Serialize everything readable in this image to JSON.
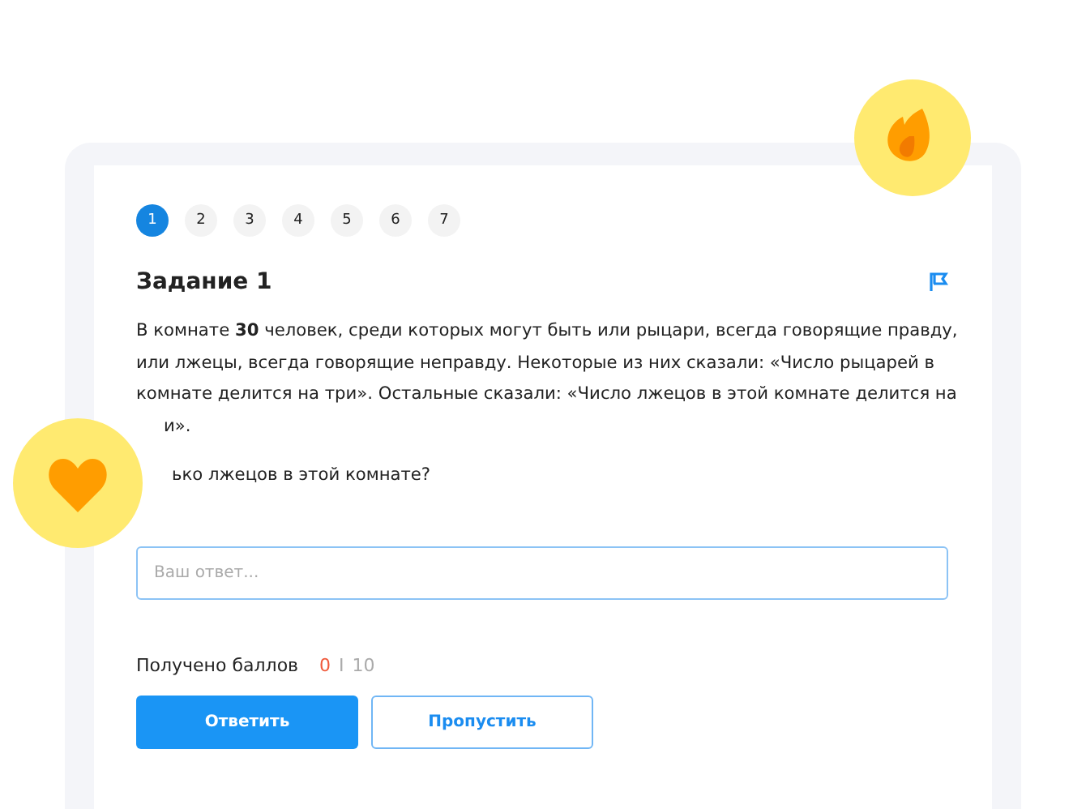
{
  "pages": [
    {
      "label": "1",
      "selected": true
    },
    {
      "label": "2",
      "selected": false
    },
    {
      "label": "3",
      "selected": false
    },
    {
      "label": "4",
      "selected": false
    },
    {
      "label": "5",
      "selected": false
    },
    {
      "label": "6",
      "selected": false
    },
    {
      "label": "7",
      "selected": false
    }
  ],
  "task": {
    "title": "Задание 1",
    "lines": [
      "В комнате **30** человек, среди которых могут быть или рыцари, всегда говорящие правду,",
      "или лжецы, всегда говорящие неправду. Некоторые из них сказали: «Число рыцарей в",
      "комнате делится на три». Остальные сказали: «Число лжецов в этой комнате делится на"
    ],
    "line_end": "и».",
    "question": "ько лжецов в этой комнате?"
  },
  "answer": {
    "placeholder": "Ваш ответ..."
  },
  "score": {
    "label": "Получено баллов",
    "earned": "0",
    "separator": "I",
    "total": "10"
  },
  "buttons": [
    {
      "label": "Ответить",
      "kind": "primary"
    },
    {
      "label": "Пропустить",
      "kind": "secondary"
    }
  ]
}
